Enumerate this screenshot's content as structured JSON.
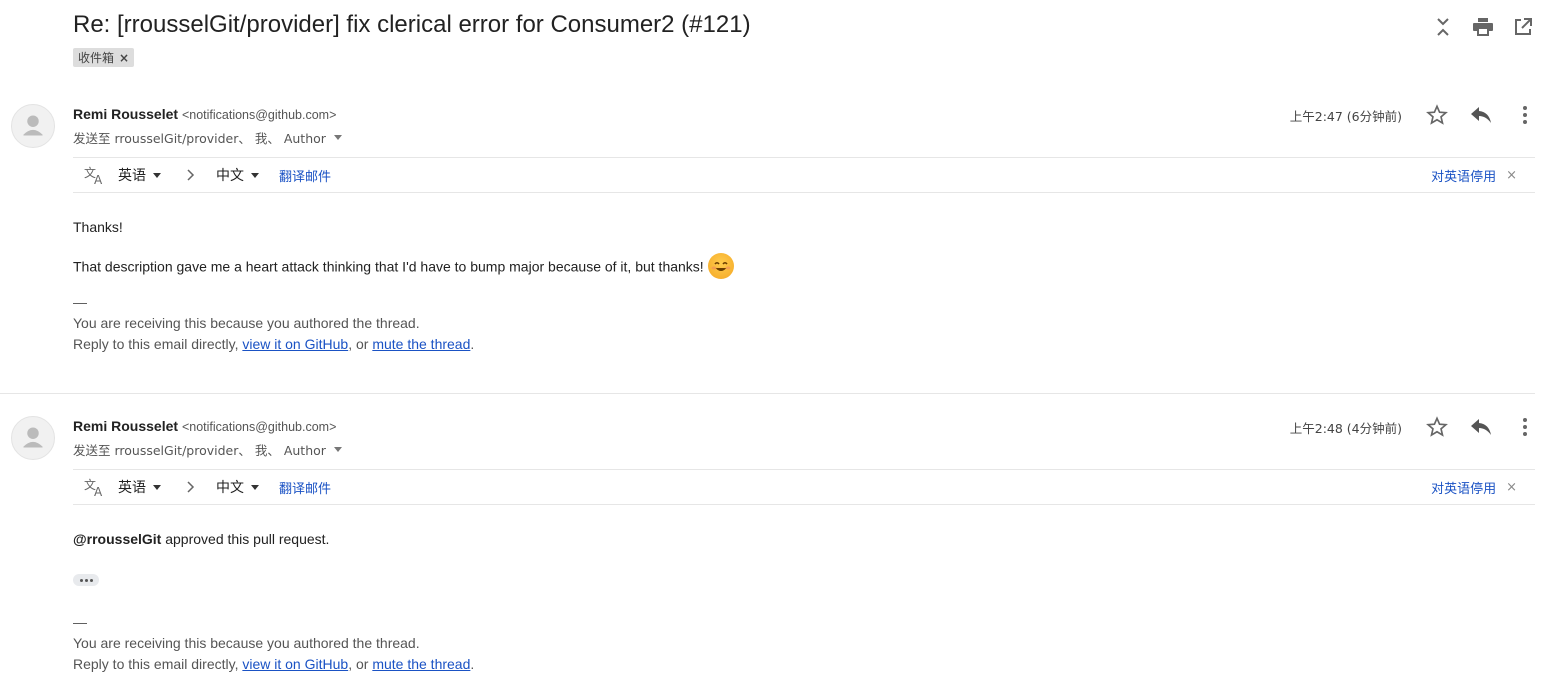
{
  "subject": "Re: [rrousselGit/provider] fix clerical error for Consumer2 (#121)",
  "label": "收件箱",
  "label_remove": "×",
  "colors": {
    "link": "#1a52c4",
    "chip": "#dddddd"
  },
  "messages": [
    {
      "sender_name": "Remi Rousselet",
      "sender_email": "<notifications@github.com>",
      "recipients": "发送至 rrousselGit/provider、 我、 Author",
      "time": "上午2:47 (6分钟前)",
      "translate": {
        "source": "英语",
        "target": "中文",
        "translate_link": "翻译邮件",
        "disable_link": "对英语停用",
        "close": "×"
      },
      "body": [
        "Thanks!",
        "That description gave me a heart attack thinking that I'd have to bump major because of it, but thanks!"
      ],
      "footer": {
        "dash": "—",
        "line1": "You are receiving this because you authored the thread.",
        "line2_prefix": "Reply to this email directly, ",
        "link1": "view it on GitHub",
        "mid": ", or ",
        "link2": "mute the thread",
        "suffix": "."
      }
    },
    {
      "sender_name": "Remi Rousselet",
      "sender_email": "<notifications@github.com>",
      "recipients": "发送至 rrousselGit/provider、 我、 Author",
      "time": "上午2:48 (4分钟前)",
      "translate": {
        "source": "英语",
        "target": "中文",
        "translate_link": "翻译邮件",
        "disable_link": "对英语停用",
        "close": "×"
      },
      "body_user": "@rrousselGit",
      "body_rest": " approved this pull request.",
      "footer": {
        "dash": "—",
        "line1": "You are receiving this because you authored the thread.",
        "line2_prefix": "Reply to this email directly, ",
        "link1": "view it on GitHub",
        "mid": ", or ",
        "link2": "mute the thread",
        "suffix": "."
      }
    }
  ]
}
